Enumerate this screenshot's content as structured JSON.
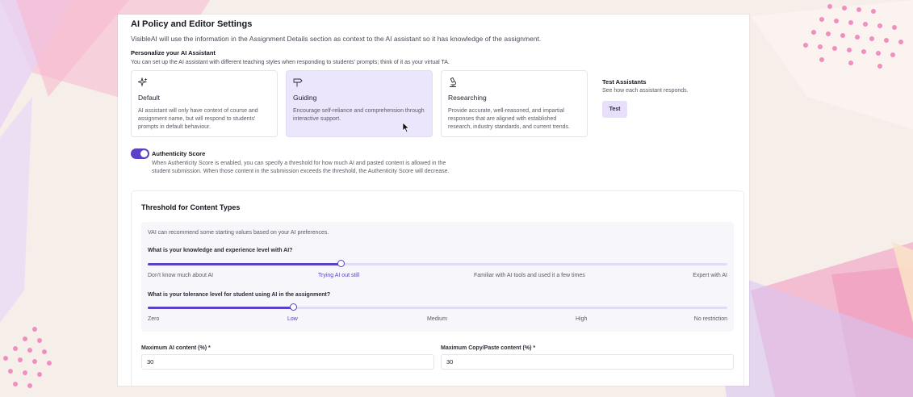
{
  "page": {
    "title": "AI Policy and Editor Settings",
    "description": "VisibleAI will use the information in the Assignment Details section as context to the AI assistant so it has knowledge of the assignment."
  },
  "personalize": {
    "heading": "Personalize your AI Assistant",
    "description": "You can set up the AI assistant with different teaching styles when responding to students' prompts; think of it as your virtual TA.",
    "cards": [
      {
        "icon": "sparkle-icon",
        "title": "Default",
        "text": "AI assistant will only have context of course and assignment name, but will respond to students' prompts in default behaviour.",
        "selected": false
      },
      {
        "icon": "signpost-icon",
        "title": "Guiding",
        "text": "Encourage self-reliance and comprehension through interactive support.",
        "selected": true
      },
      {
        "icon": "microscope-icon",
        "title": "Researching",
        "text": "Provide accurate, well-reasoned, and impartial responses that are aligned with established research, industry standards, and current trends.",
        "selected": false
      }
    ]
  },
  "test": {
    "heading": "Test Assistants",
    "description": "See how each assistant responds.",
    "button": "Test"
  },
  "authenticity": {
    "enabled": true,
    "label": "Authenticity Score",
    "description": "When Authenticity Score is enabled, you can specify a threshold for how much AI and pasted content is allowed in the student submission. When those content in the submission exceeds the threshold, the Authenticity Score will decrease."
  },
  "threshold": {
    "title": "Threshold for Content Types",
    "recommend": "VAI can recommend some starting values based on your AI preferences.",
    "sliders": [
      {
        "question": "What is your knowledge and experience level with AI?",
        "options": [
          "Don't know much about AI",
          "Trying AI out still",
          "Familiar with AI tools and used it a few times",
          "Expert with AI"
        ],
        "selected_index": 1,
        "value_fraction": 0.333
      },
      {
        "question": "What is your tolerance level for student using AI in the assignment?",
        "options": [
          "Zero",
          "Low",
          "Medium",
          "High",
          "No restriction"
        ],
        "selected_index": 1,
        "value_fraction": 0.25
      }
    ],
    "fields": [
      {
        "label": "Maximum AI content (%) *",
        "value": "30"
      },
      {
        "label": "Maximum Copy/Paste content (%) *",
        "value": "30"
      }
    ]
  },
  "colors": {
    "accent": "#5b41c6",
    "selected_card": "#ebe6fb",
    "background": "#f6efe9"
  }
}
